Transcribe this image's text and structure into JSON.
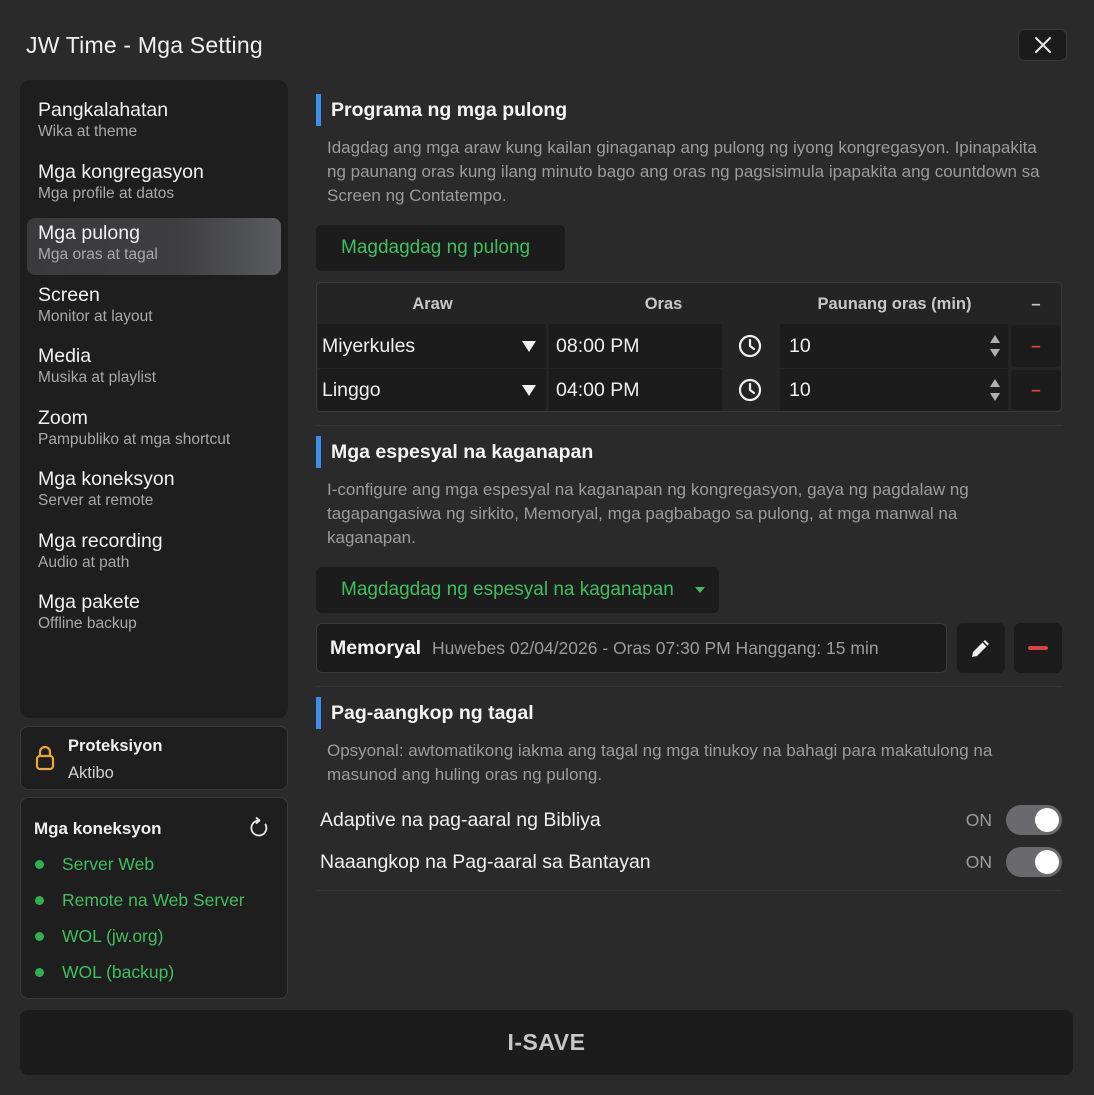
{
  "window": {
    "title": "JW Time - Mga Setting"
  },
  "sidebar": {
    "items": [
      {
        "label": "Pangkalahatan",
        "sub": "Wika at theme"
      },
      {
        "label": "Mga kongregasyon",
        "sub": "Mga profile at datos"
      },
      {
        "label": "Mga pulong",
        "sub": "Mga oras at tagal"
      },
      {
        "label": "Screen",
        "sub": "Monitor at layout"
      },
      {
        "label": "Media",
        "sub": "Musika at playlist"
      },
      {
        "label": "Zoom",
        "sub": "Pampubliko at mga shortcut"
      },
      {
        "label": "Mga koneksyon",
        "sub": "Server at remote"
      },
      {
        "label": "Mga recording",
        "sub": "Audio at path"
      },
      {
        "label": "Mga pakete",
        "sub": "Offline backup"
      }
    ],
    "active_index": 2
  },
  "protection": {
    "title": "Proteksiyon",
    "status": "Aktibo",
    "icon": "lock-icon",
    "color": "#e8a93a"
  },
  "connections": {
    "title": "Mga koneksyon",
    "items": [
      "Server Web",
      "Remote na Web Server",
      "WOL (jw.org)",
      "WOL (backup)"
    ],
    "status_color": "#2fb04f"
  },
  "schedule": {
    "title": "Programa ng mga pulong",
    "description": "Idagdag ang mga araw kung kailan ginaganap ang pulong ng iyong kongregasyon. Ipinapakita ng paunang oras kung ilang minuto bago ang oras ng pagsisimula ipapakita ang countdown sa Screen ng Contatempo.",
    "add_button": "Magdagdag ng pulong",
    "columns": [
      "Araw",
      "Oras",
      "Paunang oras (min)",
      "–"
    ],
    "rows": [
      {
        "day": "Miyerkules",
        "time": "08:00 PM",
        "pre": "10"
      },
      {
        "day": "Linggo",
        "time": "04:00 PM",
        "pre": "10"
      }
    ],
    "remove_symbol": "–"
  },
  "special_events": {
    "title": "Mga espesyal na kaganapan",
    "description": "I-configure ang mga espesyal na kaganapan ng kongregasyon, gaya ng pagdalaw ng tagapangasiwa ng sirkito, Memoryal, mga pagbabago sa pulong, at mga manwal na kaganapan.",
    "add_button": "Magdagdag ng espesyal na kaganapan",
    "event": {
      "name": "Memoryal",
      "details": "Huwebes 02/04/2026 - Oras 07:30 PM Hanggang: 15 min"
    }
  },
  "adaptation": {
    "title": "Pag-aangkop ng tagal",
    "description": "Opsyonal: awtomatikong iakma ang tagal ng mga tinukoy na bahagi para makatulong na masunod ang huling oras ng pulong.",
    "toggles": [
      {
        "label": "Adaptive na pag-aaral ng Bibliya",
        "state": "ON",
        "on": true
      },
      {
        "label": "Naaangkop na Pag-aaral sa Bantayan",
        "state": "ON",
        "on": true
      }
    ]
  },
  "footer": {
    "save_label": "I-SAVE"
  },
  "colors": {
    "accent": "#3b8eea",
    "green": "#3fbf5f",
    "danger": "#e04040"
  }
}
